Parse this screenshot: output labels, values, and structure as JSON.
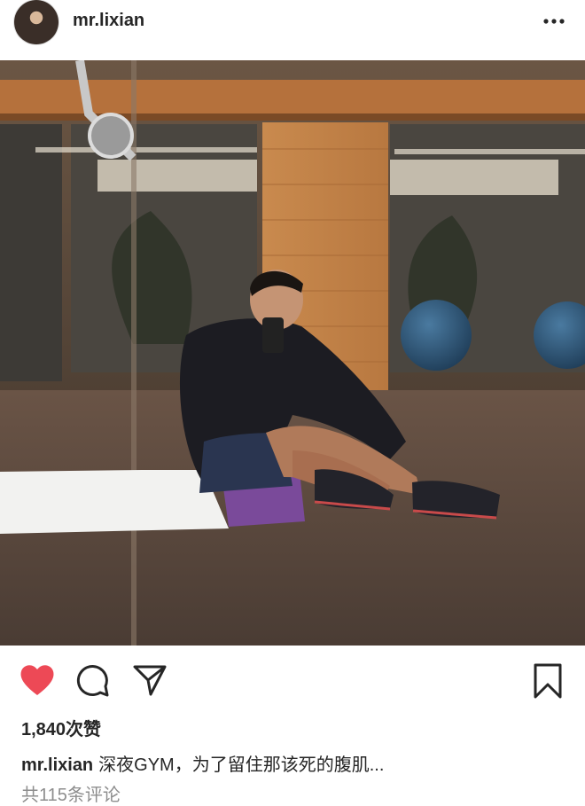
{
  "post": {
    "username": "mr.lixian",
    "likes_text": "1,840次赞",
    "caption_user": "mr.lixian",
    "caption_text": "深夜GYM，为了留住那该死的腹肌...",
    "comments_text": "共115条评论"
  },
  "icons": {
    "more": "more-horizontal-icon",
    "like": "heart-filled-icon",
    "comment": "comment-bubble-icon",
    "share": "paper-plane-icon",
    "save": "bookmark-icon"
  },
  "colors": {
    "like_active": "#ed4956",
    "text": "#262626",
    "muted": "#8e8e8e"
  }
}
